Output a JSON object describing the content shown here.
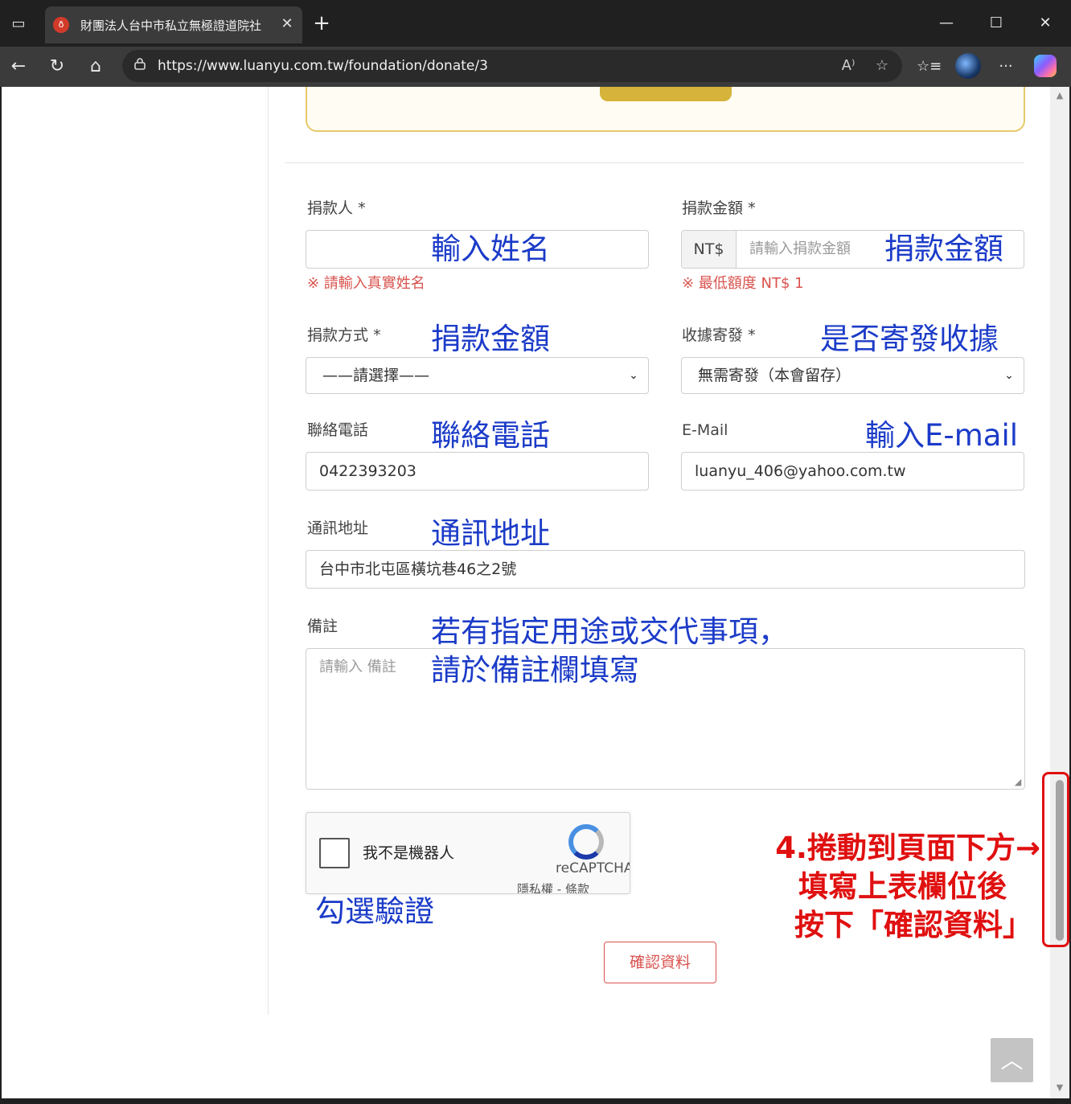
{
  "browser": {
    "tab": {
      "title": "財團法人台中市私立無極證道院社",
      "favicon": "red-flame-logo",
      "close_glyph": "✕"
    },
    "new_tab_glyph": "+",
    "window_controls": {
      "minimize": "—",
      "maximize": "☐",
      "close": "✕"
    },
    "address": {
      "url": "https://www.luanyu.com.tw/foundation/donate/3"
    },
    "nav_glyphs": {
      "back": "←",
      "reload": "↻",
      "home": "⌂",
      "lock": "🔒",
      "read_aloud": "A⁾",
      "favorite": "☆",
      "favorites_list": "☆≡",
      "more": "···"
    }
  },
  "form": {
    "donor": {
      "label": "捐款人",
      "required": "*",
      "value": "",
      "hint": "※ 請輸入真實姓名"
    },
    "amount": {
      "label": "捐款金額",
      "required": "*",
      "prefix": "NT$",
      "placeholder": "請輸入捐款金額",
      "hint": "※ 最低額度 NT$ 1"
    },
    "method": {
      "label": "捐款方式",
      "required": "*",
      "selected": "——請選擇——"
    },
    "receipt": {
      "label": "收據寄發",
      "required": "*",
      "selected": "無需寄發（本會留存）"
    },
    "phone": {
      "label": "聯絡電話",
      "value": "0422393203"
    },
    "email": {
      "label": "E-Mail",
      "value": "luanyu_406@yahoo.com.tw"
    },
    "address": {
      "label": "通訊地址",
      "value": "台中市北屯區橫坑巷46之2號"
    },
    "remark": {
      "label": "備註",
      "placeholder": "請輸入 備註"
    },
    "recaptcha": {
      "label": "我不是機器人",
      "brand": "reCAPTCHA",
      "terms": "隱私權 - 條款"
    },
    "confirm_button": "確認資料"
  },
  "back_to_top_glyph": "︿",
  "annotations": {
    "donor_name": "輸入姓名",
    "amount": "捐款金額",
    "method": "捐款金額",
    "receipt": "是否寄發收據",
    "phone": "聯絡電話",
    "email": "輸入E-mail",
    "address": "通訊地址",
    "remark_line1": "若有指定用途或交代事項，",
    "remark_line2": "請於備註欄填寫",
    "captcha": "勾選驗證",
    "step_line1": "4.捲動到頁面下方→",
    "step_line2": "填寫上表欄位後",
    "step_line3": "按下「確認資料」"
  },
  "colors": {
    "accent_red": "#d9534f",
    "annotation_blue": "#1b3bc8",
    "annotation_red": "#e01010",
    "panel_gold": "#d6b33a"
  }
}
